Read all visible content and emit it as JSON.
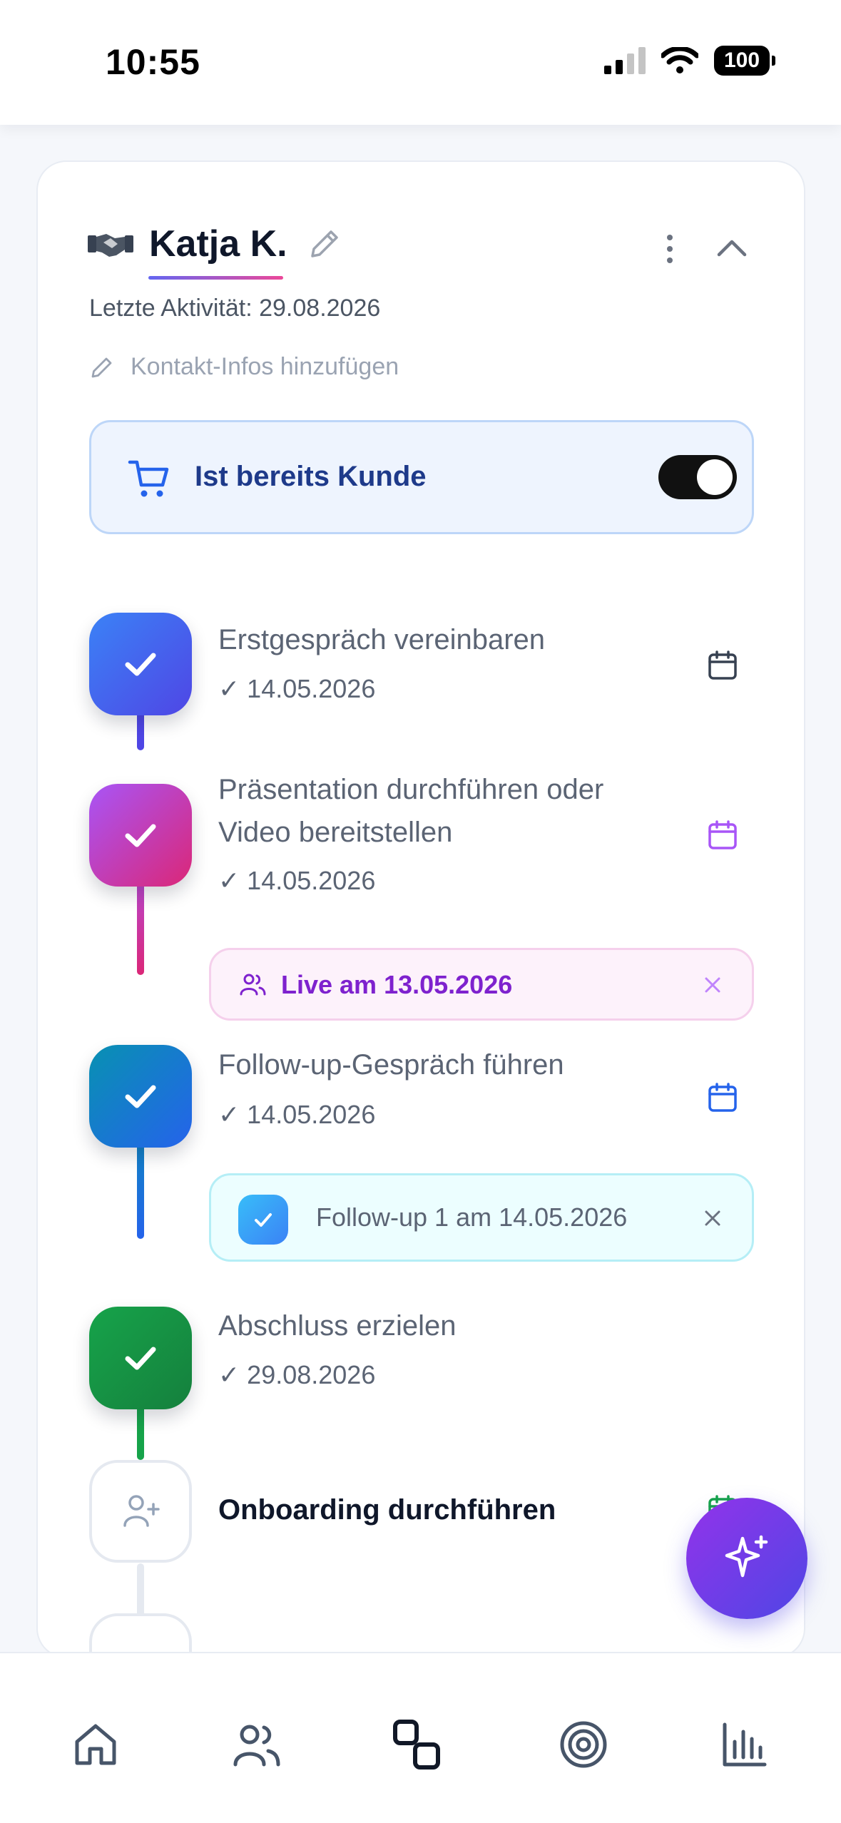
{
  "status_bar": {
    "time": "10:55",
    "battery": "100"
  },
  "contact": {
    "name": "Katja K.",
    "last_activity": "Letzte Aktivität: 29.08.2026",
    "add_contact_info": "Kontakt-Infos hinzufügen"
  },
  "customer_toggle": {
    "label": "Ist bereits Kunde",
    "on": true
  },
  "steps": [
    {
      "title": "Erstgespräch vereinbaren",
      "date": "✓ 14.05.2026",
      "color": "#4f46e5"
    },
    {
      "title_line1": "Präsentation durchführen oder",
      "title_line2": "Video bereitstellen",
      "date": "✓ 14.05.2026",
      "color": "#c026d3"
    },
    {
      "title": "Follow-up-Gespräch führen",
      "date": "✓ 14.05.2026",
      "color": "#2563eb"
    },
    {
      "title": "Abschluss erzielen",
      "date": "✓ 29.08.2026",
      "color": "#16a34a"
    },
    {
      "title": "Onboarding durchführen"
    }
  ],
  "chips": {
    "live": "Live am 13.05.2026",
    "followup": "Follow-up 1 am 14.05.2026"
  },
  "colors": {
    "accent_blue": "#1e3a8a",
    "live_purple": "#7e22ce",
    "fab_gradient_start": "#9333ea",
    "fab_gradient_end": "#4f46e5"
  },
  "nav": [
    "home-icon",
    "users-icon",
    "pipeline-icon",
    "target-icon",
    "stats-icon"
  ]
}
